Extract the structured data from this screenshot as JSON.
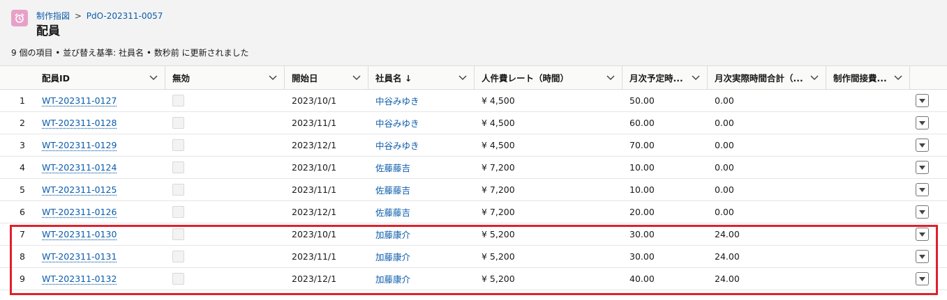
{
  "header": {
    "breadcrumb_parent": "制作指図",
    "breadcrumb_sep": ">",
    "breadcrumb_record": "PdO-202311-0057",
    "title": "配員",
    "meta": "9 個の項目 • 並び替え基準: 社員名 • 数秒前 に更新されました"
  },
  "columns": [
    {
      "label": "配員ID"
    },
    {
      "label": "無効"
    },
    {
      "label": "開始日"
    },
    {
      "label": "社員名 ↓"
    },
    {
      "label": "人件費レート（時間）"
    },
    {
      "label": "月次予定時..."
    },
    {
      "label": "月次実際時間合計（..."
    },
    {
      "label": "制作間接費..."
    }
  ],
  "rows": [
    {
      "n": "1",
      "id": "WT-202311-0127",
      "start": "2023/10/1",
      "emp": "中谷みゆき",
      "rate": "¥ 4,500",
      "plan": "50.00",
      "actual": "0.00"
    },
    {
      "n": "2",
      "id": "WT-202311-0128",
      "start": "2023/11/1",
      "emp": "中谷みゆき",
      "rate": "¥ 4,500",
      "plan": "60.00",
      "actual": "0.00"
    },
    {
      "n": "3",
      "id": "WT-202311-0129",
      "start": "2023/12/1",
      "emp": "中谷みゆき",
      "rate": "¥ 4,500",
      "plan": "70.00",
      "actual": "0.00"
    },
    {
      "n": "4",
      "id": "WT-202311-0124",
      "start": "2023/10/1",
      "emp": "佐藤藤吉",
      "rate": "¥ 7,200",
      "plan": "10.00",
      "actual": "0.00"
    },
    {
      "n": "5",
      "id": "WT-202311-0125",
      "start": "2023/11/1",
      "emp": "佐藤藤吉",
      "rate": "¥ 7,200",
      "plan": "10.00",
      "actual": "0.00"
    },
    {
      "n": "6",
      "id": "WT-202311-0126",
      "start": "2023/12/1",
      "emp": "佐藤藤吉",
      "rate": "¥ 7,200",
      "plan": "20.00",
      "actual": "0.00"
    },
    {
      "n": "7",
      "id": "WT-202311-0130",
      "start": "2023/10/1",
      "emp": "加藤康介",
      "rate": "¥ 5,200",
      "plan": "30.00",
      "actual": "24.00"
    },
    {
      "n": "8",
      "id": "WT-202311-0131",
      "start": "2023/11/1",
      "emp": "加藤康介",
      "rate": "¥ 5,200",
      "plan": "30.00",
      "actual": "24.00"
    },
    {
      "n": "9",
      "id": "WT-202311-0132",
      "start": "2023/12/1",
      "emp": "加藤康介",
      "rate": "¥ 5,200",
      "plan": "40.00",
      "actual": "24.00"
    }
  ],
  "colors": {
    "link": "#0b5cab",
    "highlight": "#e0202b",
    "app_icon": "#e7a1c8"
  },
  "icons": {
    "app": "alarm-clock-icon",
    "column_menu": "chevron-down-icon",
    "row_action": "caret-down-icon"
  }
}
